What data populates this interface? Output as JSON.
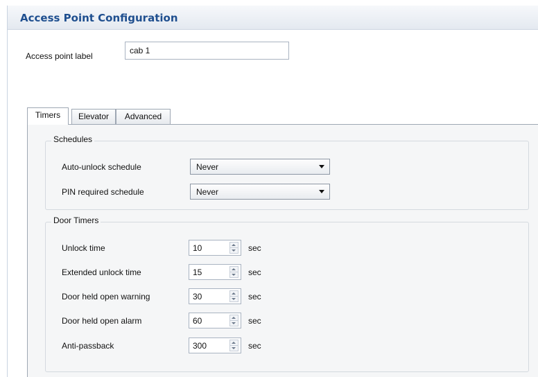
{
  "header": {
    "title": "Access Point Configuration"
  },
  "access_point": {
    "label_text": "Access point label",
    "value": "cab 1"
  },
  "tabs": [
    {
      "label": "Timers",
      "active": true
    },
    {
      "label": "Elevator",
      "active": false
    },
    {
      "label": "Advanced",
      "active": false
    }
  ],
  "schedules": {
    "title": "Schedules",
    "rows": [
      {
        "label": "Auto-unlock schedule",
        "value": "Never"
      },
      {
        "label": "PIN required schedule",
        "value": "Never"
      }
    ]
  },
  "door_timers": {
    "title": "Door Timers",
    "unit": "sec",
    "rows": [
      {
        "label": "Unlock time",
        "value": "10"
      },
      {
        "label": "Extended unlock time",
        "value": "15"
      },
      {
        "label": "Door held open warning",
        "value": "30"
      },
      {
        "label": "Door held open alarm",
        "value": "60"
      },
      {
        "label": "Anti-passback",
        "value": "300"
      }
    ]
  }
}
